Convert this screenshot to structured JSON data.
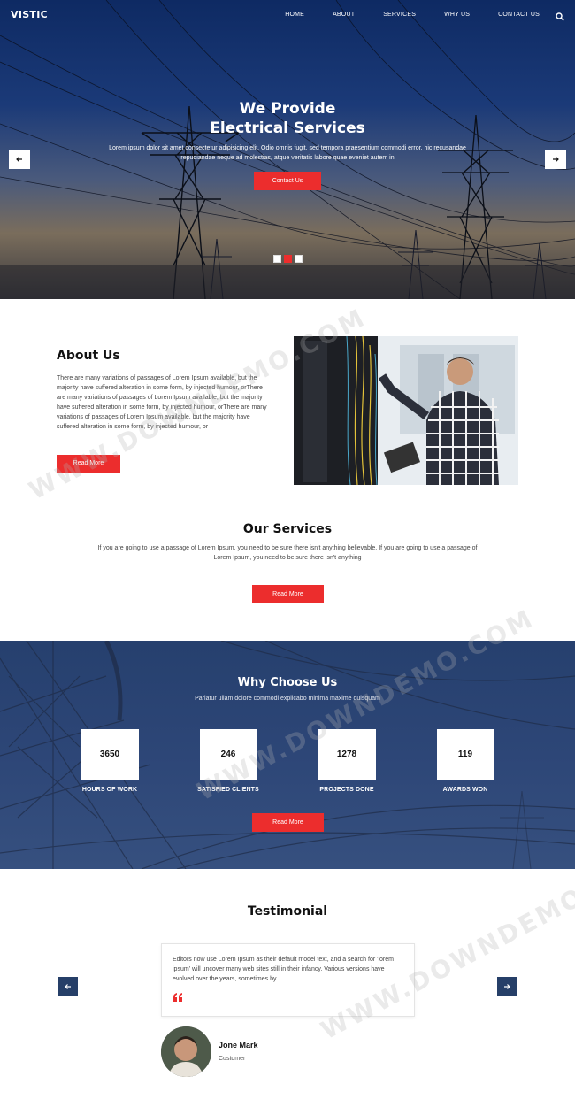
{
  "nav": {
    "logo": "VISTIC",
    "items": [
      "HOME",
      "ABOUT",
      "SERVICES",
      "WHY US",
      "CONTACT US"
    ]
  },
  "hero": {
    "title_line1": "We Provide",
    "title_line2": "Electrical Services",
    "text": "Lorem ipsum dolor sit amet consectetur adipisicing elit. Odio omnis fugit, sed tempora praesentium commodi error, hic recusandae repudiandae neque ad molestias, atque veritatis labore quae eveniet autem in",
    "button": "Contact Us"
  },
  "about": {
    "title": "About Us",
    "text": "There are many variations of passages of Lorem Ipsum available, but the majority have suffered alteration in some form, by injected humour, orThere are many variations of passages of Lorem Ipsum available, but the majority have suffered alteration in some form, by injected humour, orThere are many variations of passages of Lorem Ipsum available, but the majority have suffered alteration in some form, by injected humour, or",
    "button": "Read More"
  },
  "services": {
    "title": "Our Services",
    "text": "If you are going to use a passage of Lorem Ipsum, you need to be sure there isn't anything believable. If you are going to use a passage of Lorem Ipsum, you need to be sure there isn't anything",
    "button": "Read More"
  },
  "why": {
    "title": "Why Choose Us",
    "subtitle": "Pariatur ullam dolore commodi explicabo minima maxime quisquam",
    "stats": [
      {
        "value": "3650",
        "label": "HOURS OF WORK"
      },
      {
        "value": "246",
        "label": "SATISFIED CLIENTS"
      },
      {
        "value": "1278",
        "label": "PROJECTS DONE"
      },
      {
        "value": "119",
        "label": "AWARDS WON"
      }
    ],
    "button": "Read More"
  },
  "testimonial": {
    "title": "Testimonial",
    "text": "Editors now use Lorem Ipsum as their default model text, and a search for 'lorem ipsum' will uncover many web sites still in their infancy. Various versions have evolved over the years, sometimes by",
    "name": "Jone Mark",
    "role": "Customer"
  },
  "watermark": "WWW.DOWNDEMO.COM",
  "colors": {
    "accent": "#ec2d2d",
    "navy": "#263f68"
  }
}
